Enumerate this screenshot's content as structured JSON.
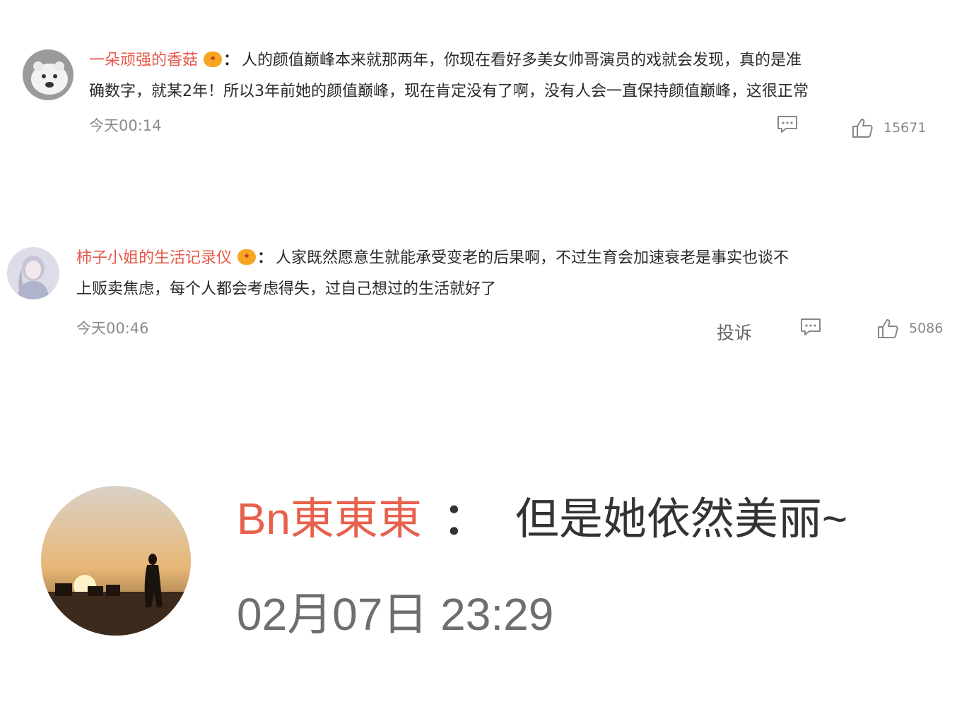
{
  "comments": [
    {
      "username": "一朵顽强的香菇",
      "badge": "vip",
      "separator": "：",
      "text_line1": "人的颜值巅峰本来就那两年，你现在看好多美女帅哥演员的戏就会发现，真的是准",
      "text_line2": "确数字，就某2年！所以3年前她的颜值巅峰，现在肯定没有了啊，没有人会一直保持颜值巅峰，这很正常",
      "time": "今天00:14",
      "likes": "15671",
      "avatar_icon": "polar-bear-avatar"
    },
    {
      "username": "柿子小姐的生活记录仪",
      "badge": "vip",
      "separator": "：",
      "text_line1": "人家既然愿意生就能承受变老的后果啊，不过生育会加速衰老是事实也谈不",
      "text_line2": "上贩卖焦虑，每个人都会考虑得失，过自己想过的生活就好了",
      "time": "今天00:46",
      "report_label": "投诉",
      "likes": "5086",
      "avatar_icon": "girl-avatar"
    },
    {
      "username": "Bn東東東",
      "separator": "：",
      "text": "但是她依然美丽~",
      "time": "02月07日 23:29",
      "avatar_icon": "sunset-silhouette-avatar"
    }
  ],
  "colors": {
    "username": "#e5584a",
    "text": "#2a2a2a",
    "muted": "#8a8a8a"
  },
  "icons": {
    "comment": "comment-icon",
    "like": "thumbs-up-icon",
    "badge": "vip-badge-icon"
  }
}
